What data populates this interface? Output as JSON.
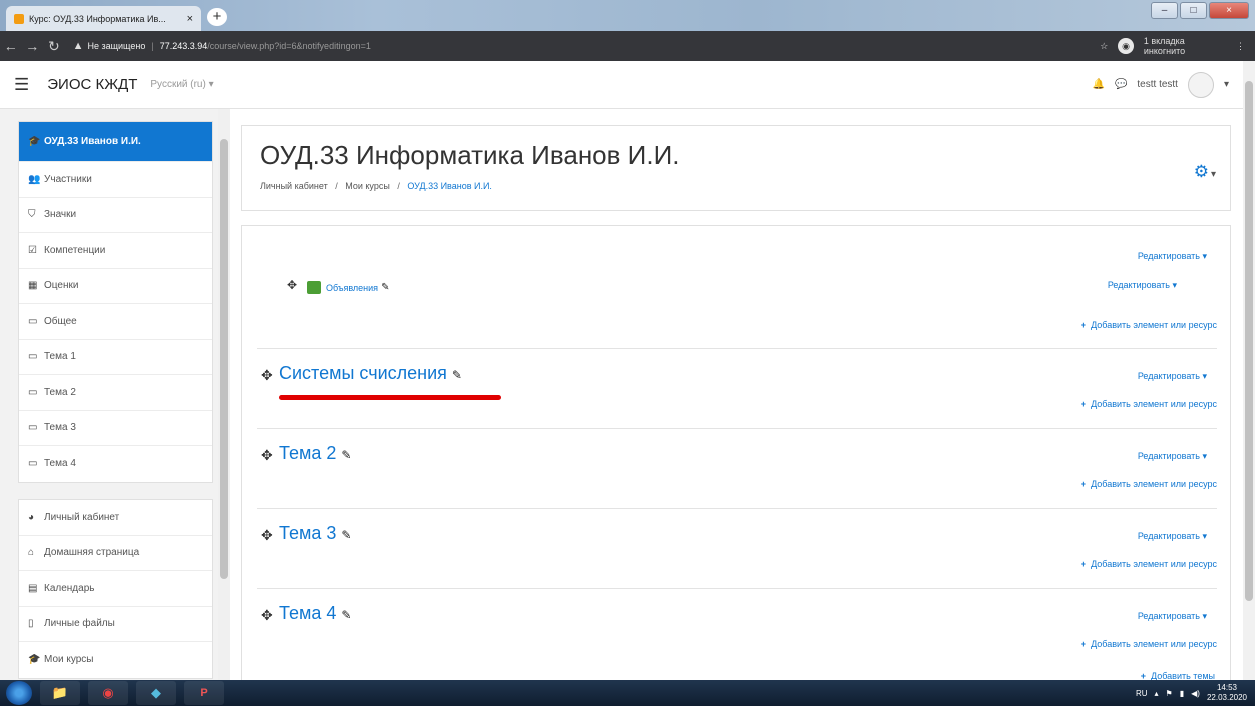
{
  "browser": {
    "tab_title": "Курс: ОУД.33 Информатика Ив...",
    "tab_close": "×",
    "new_tab": "+",
    "insecure_label": "Не защищено",
    "url_host": "77.243.3.94",
    "url_path": "/course/view.php?id=6&notifyeditingon=1",
    "incognito_label": "1 вкладка инкогнито",
    "window_buttons": [
      "–",
      "□",
      "×"
    ]
  },
  "navbar": {
    "site_name": "ЭИОС КЖДТ",
    "language": "Русский (ru) ▾",
    "user_name": "testt testt"
  },
  "drawer": {
    "course_items": [
      {
        "label": "ОУД.33 Иванов И.И.",
        "icon": "graduation-cap-icon",
        "active": true
      },
      {
        "label": "Участники",
        "icon": "users-icon"
      },
      {
        "label": "Значки",
        "icon": "shield-icon"
      },
      {
        "label": "Компетенции",
        "icon": "checkbox-icon"
      },
      {
        "label": "Оценки",
        "icon": "table-icon"
      },
      {
        "label": "Общее",
        "icon": "folder-icon"
      },
      {
        "label": "Тема 1",
        "icon": "folder-icon"
      },
      {
        "label": "Тема 2",
        "icon": "folder-icon"
      },
      {
        "label": "Тема 3",
        "icon": "folder-icon"
      },
      {
        "label": "Тема 4",
        "icon": "folder-icon"
      }
    ],
    "site_items": [
      {
        "label": "Личный кабинет",
        "icon": "dashboard-icon"
      },
      {
        "label": "Домашняя страница",
        "icon": "home-icon"
      },
      {
        "label": "Календарь",
        "icon": "calendar-icon"
      },
      {
        "label": "Личные файлы",
        "icon": "file-icon"
      },
      {
        "label": "Мои курсы",
        "icon": "graduation-cap-icon"
      }
    ]
  },
  "header": {
    "title": "ОУД.33 Информатика Иванов И.И.",
    "breadcrumb": [
      "Личный кабинет",
      "Мои курсы",
      "ОУД.33 Иванов И.И."
    ],
    "breadcrumb_separator": "/"
  },
  "course": {
    "edit_label": "Редактировать ▾",
    "add_label": "Добавить элемент или ресурс",
    "add_topics_label": "Добавить темы",
    "general": {
      "activity_name": "Объявления"
    },
    "sections": [
      {
        "title": "Системы счисления",
        "highlighted": true
      },
      {
        "title": "Тема 2"
      },
      {
        "title": "Тема 3"
      },
      {
        "title": "Тема 4"
      }
    ]
  },
  "taskbar": {
    "lang": "RU",
    "time": "14:53",
    "date": "22.03.2020"
  },
  "colors": {
    "accent": "#1177d1",
    "highlight": "#e00000"
  }
}
